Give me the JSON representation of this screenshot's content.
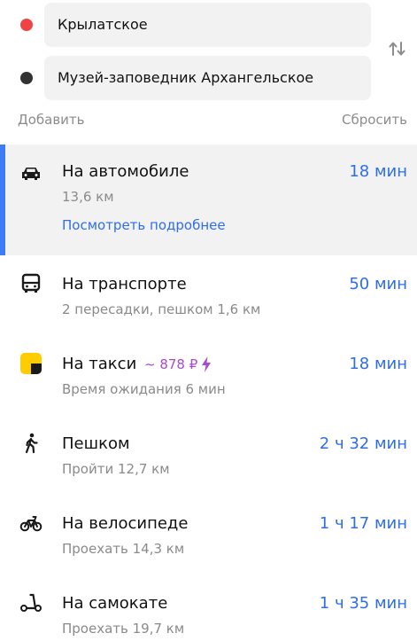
{
  "route_points": [
    {
      "label": "Крылатское",
      "color": "#f04444"
    },
    {
      "label": "Музей-заповедник Архангельское",
      "color": "#333333"
    }
  ],
  "actions": {
    "add": "Добавить",
    "reset": "Сбросить"
  },
  "routes": [
    {
      "mode": "car",
      "icon": "car-icon",
      "title": "На автомобиле",
      "subtitle": "13,6 км",
      "time": "18 мин",
      "link": "Посмотреть подробнее",
      "selected": true
    },
    {
      "mode": "transit",
      "icon": "bus-icon",
      "title": "На транспорте",
      "subtitle": "2 пересадки, пешком 1,6 км",
      "time": "50 мин"
    },
    {
      "mode": "taxi",
      "icon": "taxi-icon",
      "title": "На такси",
      "price": "~ 878 ₽",
      "subtitle": "Время ожидания 6 мин",
      "time": "18 мин"
    },
    {
      "mode": "walk",
      "icon": "pedestrian-icon",
      "title": "Пешком",
      "subtitle": "Пройти 12,7 км",
      "time": "2 ч 32 мин"
    },
    {
      "mode": "bike",
      "icon": "bicycle-icon",
      "title": "На велосипеде",
      "subtitle": "Проехать 14,3 км",
      "time": "1 ч 17 мин"
    },
    {
      "mode": "scooter",
      "icon": "scooter-icon",
      "title": "На самокате",
      "subtitle": "Проехать 19,7 км",
      "time": "1 ч 35 мин"
    }
  ],
  "colors": {
    "accent": "#2f6ee8",
    "selected_bar": "#3d7cf5",
    "taxi_price": "#a94ad0",
    "start_dot": "#f04444",
    "end_dot": "#333333"
  }
}
